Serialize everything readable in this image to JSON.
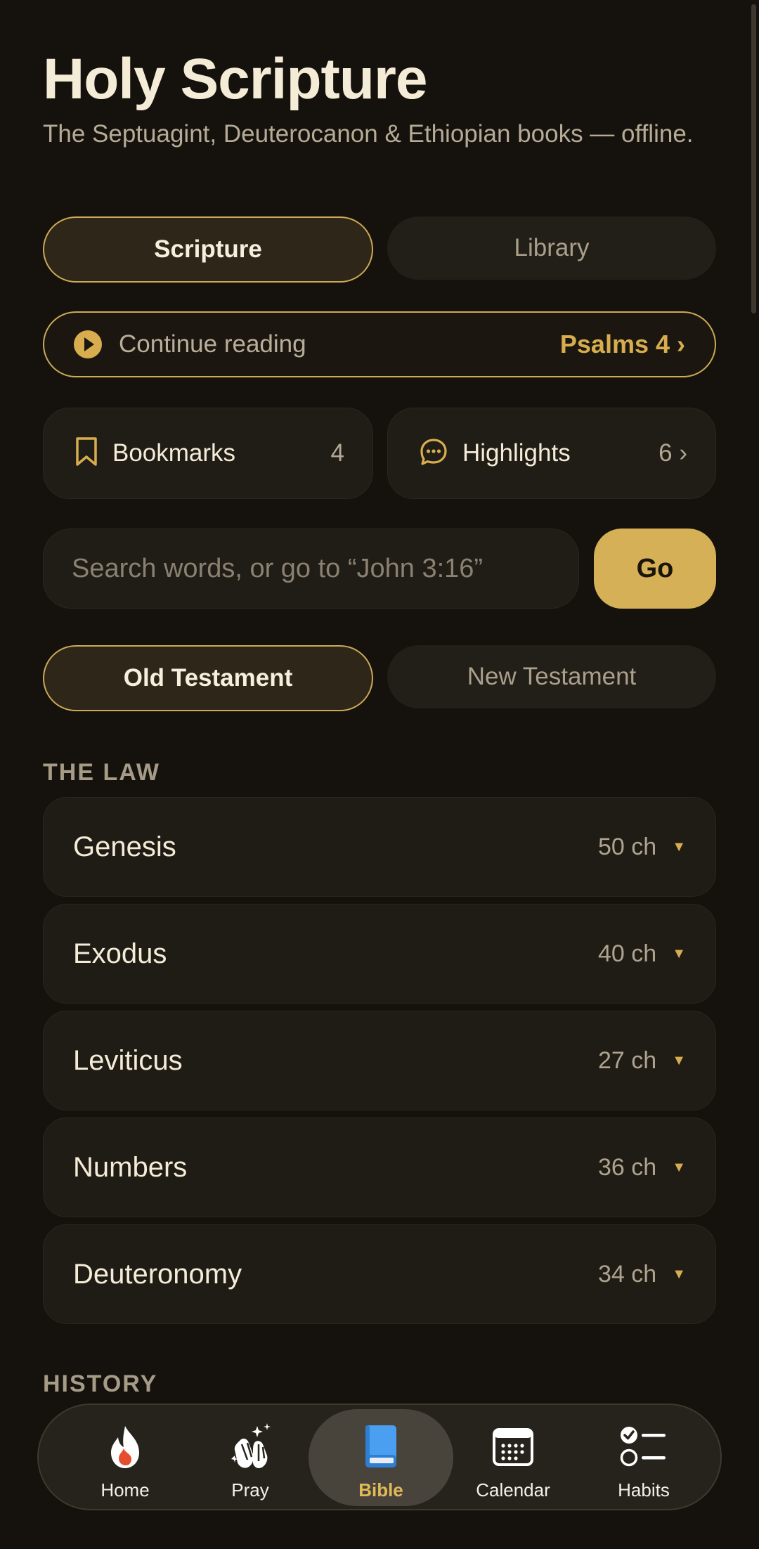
{
  "header": {
    "title": "Holy Scripture",
    "subtitle": "The Septuagint, Deuterocanon & Ethiopian books — offline."
  },
  "mode_tabs": [
    {
      "label": "Scripture",
      "active": true
    },
    {
      "label": "Library",
      "active": false
    }
  ],
  "continue_reading": {
    "label": "Continue reading",
    "target": "Psalms 4 ›",
    "icon": "play-circle-icon"
  },
  "quick_cards": {
    "bookmarks": {
      "label": "Bookmarks",
      "count": "4",
      "icon": "bookmark-icon"
    },
    "highlights": {
      "label": "Highlights",
      "count": "6 ›",
      "icon": "chat-bubble-icon"
    }
  },
  "search": {
    "placeholder": "Search words, or go to “John 3:16”",
    "button_label": "Go"
  },
  "testament_tabs": [
    {
      "label": "Old Testament",
      "active": true
    },
    {
      "label": "New Testament",
      "active": false
    }
  ],
  "sections": [
    {
      "title": "THE LAW",
      "books": [
        {
          "name": "Genesis",
          "chapters": "50 ch"
        },
        {
          "name": "Exodus",
          "chapters": "40 ch"
        },
        {
          "name": "Leviticus",
          "chapters": "27 ch"
        },
        {
          "name": "Numbers",
          "chapters": "36 ch"
        },
        {
          "name": "Deuteronomy",
          "chapters": "34 ch"
        }
      ]
    },
    {
      "title": "HISTORY"
    }
  ],
  "bottom_nav": [
    {
      "label": "Home",
      "icon": "flame-icon",
      "active": false
    },
    {
      "label": "Pray",
      "icon": "praying-hands-icon",
      "active": false
    },
    {
      "label": "Bible",
      "icon": "book-icon",
      "active": true
    },
    {
      "label": "Calendar",
      "icon": "calendar-icon",
      "active": false
    },
    {
      "label": "Habits",
      "icon": "checklist-icon",
      "active": false
    }
  ],
  "colors": {
    "background": "#15120d",
    "accent_gold": "#d8ad4f",
    "active_tab_border": "#cfa955",
    "bible_icon_blue": "#4a9ff0"
  }
}
